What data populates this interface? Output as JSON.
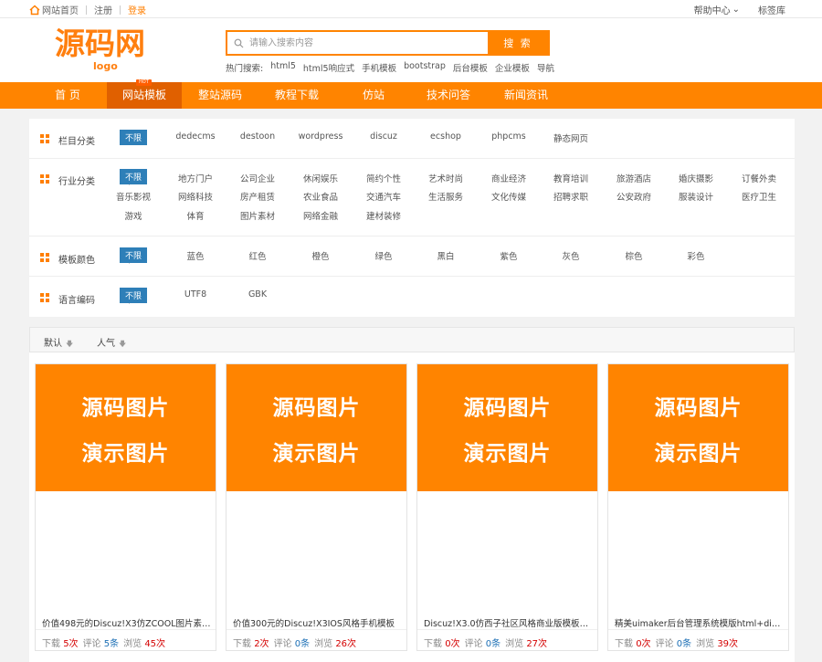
{
  "topbar": {
    "home": "网站首页",
    "register": "注册",
    "login": "登录",
    "help": "帮助中心",
    "tags": "标签库"
  },
  "logo": {
    "main": "源码网",
    "sub": "logo"
  },
  "search": {
    "placeholder": "请输入搜索内容",
    "button": "搜 索"
  },
  "hot": {
    "label": "热门搜索:",
    "items": [
      "html5",
      "html5响应式",
      "手机模板",
      "bootstrap",
      "后台模板",
      "企业模板",
      "导航"
    ]
  },
  "nav": {
    "items": [
      "首 页",
      "网站模板",
      "整站源码",
      "教程下载",
      "仿站",
      "技术问答",
      "新闻资讯"
    ],
    "hot_tag": "HOT",
    "active": "网站模板"
  },
  "filters": {
    "column": {
      "label": "栏目分类",
      "options": [
        "不限",
        "dedecms",
        "destoon",
        "wordpress",
        "discuz",
        "ecshop",
        "phpcms",
        "静态网页"
      ]
    },
    "industry": {
      "label": "行业分类",
      "options": [
        "不限",
        "地方门户",
        "公司企业",
        "休闲娱乐",
        "简约个性",
        "艺术时尚",
        "商业经济",
        "教育培训",
        "旅游酒店",
        "婚庆摄影",
        "订餐外卖",
        "音乐影视",
        "网络科技",
        "房产租赁",
        "农业食品",
        "交通汽车",
        "生活服务",
        "文化传媒",
        "招聘求职",
        "公安政府",
        "服装设计",
        "医疗卫生",
        "游戏",
        "体育",
        "图片素材",
        "网络金融",
        "建材装修"
      ]
    },
    "color": {
      "label": "模板颜色",
      "options": [
        "不限",
        "蓝色",
        "红色",
        "橙色",
        "绿色",
        "黑白",
        "紫色",
        "灰色",
        "棕色",
        "彩色"
      ]
    },
    "encoding": {
      "label": "语言编码",
      "options": [
        "不限",
        "UTF8",
        "GBK"
      ]
    }
  },
  "sort": {
    "default": "默认",
    "popular": "人气"
  },
  "thumb_text": {
    "line1": "源码图片",
    "line2": "演示图片"
  },
  "labels": {
    "download": "下载",
    "comment": "评论",
    "view": "浏览"
  },
  "cards": [
    {
      "title": "价值498元的Discuz!X3仿ZCOOL图片素材...",
      "download": "5次",
      "comment": "5条",
      "view": "45次"
    },
    {
      "title": "价值300元的Discuz!X3IOS风格手机模板",
      "download": "2次",
      "comment": "0条",
      "view": "26次"
    },
    {
      "title": "Discuz!X3.0仿西子社区风格商业版模板下载",
      "download": "0次",
      "comment": "0条",
      "view": "27次"
    },
    {
      "title": "精美uimaker后台管理系统模版html+div+...",
      "download": "0次",
      "comment": "0条",
      "view": "39次"
    }
  ],
  "colors": {
    "brand": "#ff8400",
    "nav_active": "#e06000",
    "selected_filter": "#2e7fb8"
  }
}
